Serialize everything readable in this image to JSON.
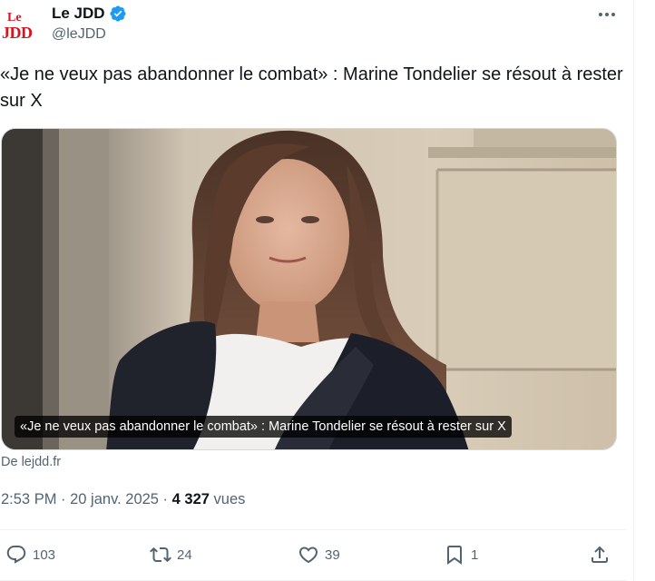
{
  "author": {
    "logo_top": "Le",
    "logo_bottom": "JDD",
    "name": "Le JDD",
    "handle": "@leJDD"
  },
  "tweet": {
    "text": "«Je ne veux pas abandonner le combat» : Marine Tondelier se résout à rester sur X"
  },
  "card": {
    "caption": "«Je ne veux pas abandonner le combat» : Marine Tondelier se résout à rester sur X",
    "source": "De lejdd.fr"
  },
  "meta": {
    "time_date": "2:53 PM · 20 janv. 2025 · ",
    "views_count": "4 327",
    "views_label": " vues"
  },
  "actions": {
    "replies": "103",
    "reposts": "24",
    "likes": "39",
    "bookmarks": "1"
  },
  "colors": {
    "verified_blue": "#1d9bf0",
    "logo_red": "#d8141e",
    "secondary_text": "#536471"
  },
  "icons": [
    "verified-badge-icon",
    "more-icon",
    "reply-icon",
    "repost-icon",
    "like-icon",
    "bookmark-icon",
    "share-icon"
  ]
}
